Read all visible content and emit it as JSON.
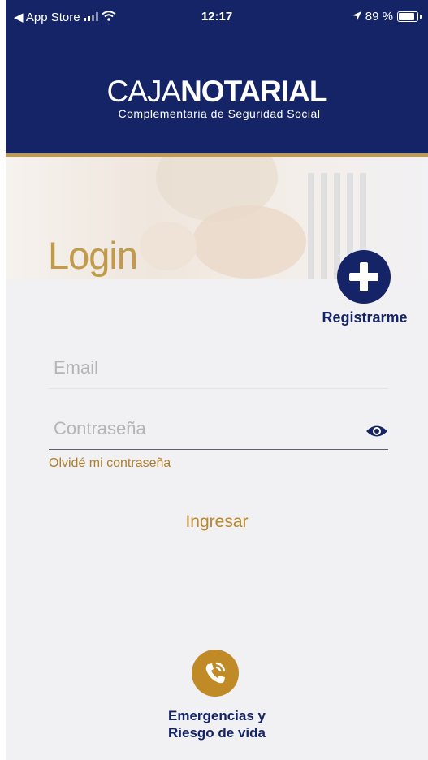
{
  "status_bar": {
    "back_app": "◀ App Store",
    "time": "12:17",
    "battery": "89 %"
  },
  "brand": {
    "name_light": "CAJA",
    "name_bold": "NOTARIAL",
    "subtitle": "Complementaria de Seguridad Social"
  },
  "login": {
    "title": "Login",
    "register_label": "Registrarme",
    "email_placeholder": "Email",
    "password_placeholder": "Contraseña",
    "forgot_password": "Olvidé mi contraseña",
    "submit": "Ingresar"
  },
  "emergency": {
    "line1": "Emergencias y",
    "line2": "Riesgo de vida",
    "icon": "phone-ringing-icon"
  },
  "colors": {
    "navy": "#152466",
    "gold": "#c19a4a",
    "background": "#f1f0f2"
  }
}
